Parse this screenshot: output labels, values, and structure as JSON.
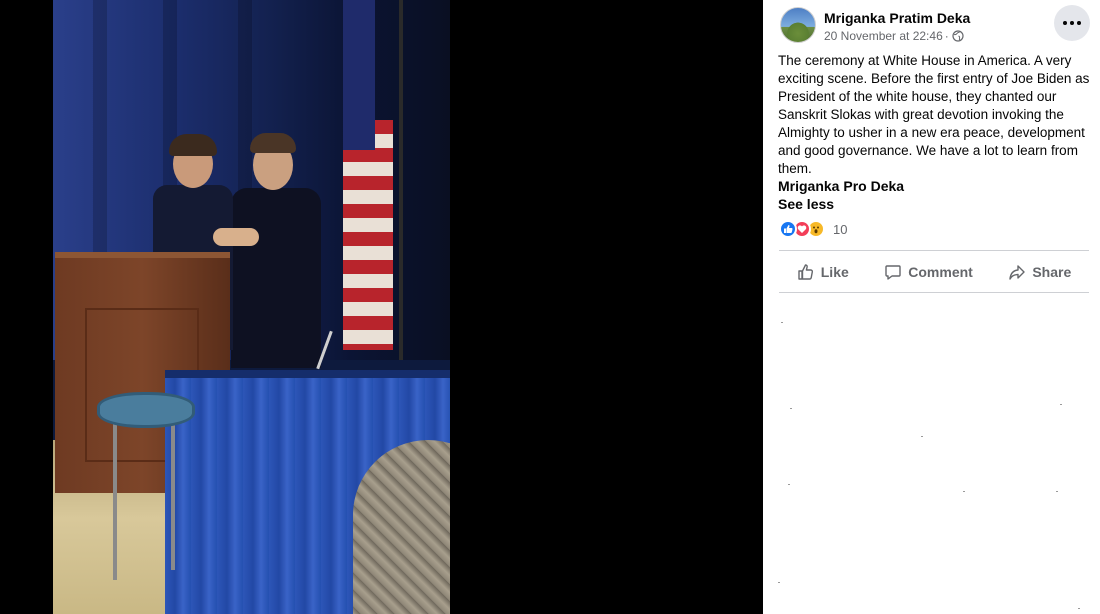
{
  "video": {
    "icon": "video-frame"
  },
  "post": {
    "author": "Mriganka Pratim Deka",
    "timestamp": "20 November at 22:46",
    "separator": "·",
    "privacy_icon": "globe-icon",
    "more_icon": "more-horizontal-icon",
    "text": "The ceremony at White House in America. A very exciting scene. Before the first entry of Joe Biden as President of the white house, they chanted our Sanskrit Slokas with great devotion invoking the Almighty to usher in a new era peace, development and good governance. We have a lot to learn from them.",
    "page_name": "Mriganka Pro Deka",
    "see_less": "See less",
    "reactions": {
      "icons": [
        "like-reaction-icon",
        "love-reaction-icon",
        "wow-reaction-icon"
      ],
      "count": "10"
    },
    "actions": {
      "like": "Like",
      "comment": "Comment",
      "share": "Share"
    }
  },
  "colors": {
    "accent": "#1877f2",
    "text_primary": "#050505",
    "text_secondary": "#65676b",
    "love": "#f33e58",
    "wow": "#f7b928"
  }
}
